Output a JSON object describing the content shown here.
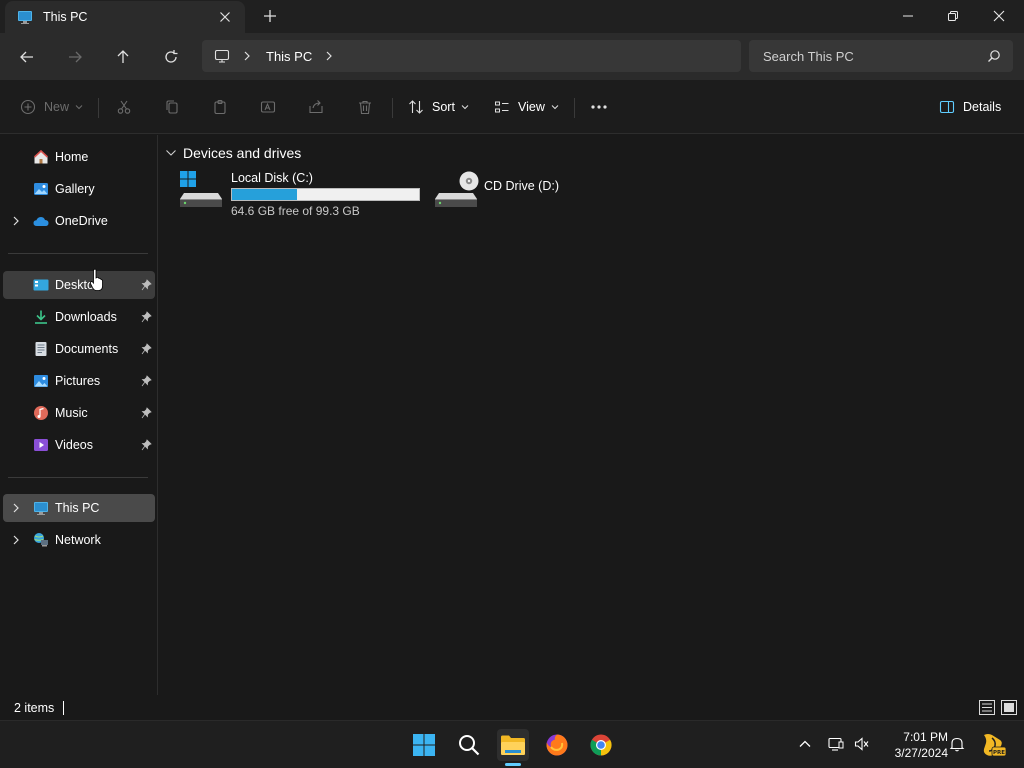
{
  "window": {
    "tab_title": "This PC",
    "controls": {
      "minimize": "minimize",
      "maximize": "restore",
      "close": "close"
    }
  },
  "address": {
    "crumbs": [
      "This PC"
    ],
    "search_placeholder": "Search This PC"
  },
  "commands": {
    "new_label": "New",
    "sort_label": "Sort",
    "view_label": "View",
    "details_label": "Details"
  },
  "sidebar": {
    "items": [
      {
        "label": "Home",
        "icon": "home-icon"
      },
      {
        "label": "Gallery",
        "icon": "gallery-icon"
      },
      {
        "label": "OneDrive",
        "icon": "cloud-icon"
      },
      {
        "label": "Deskto",
        "icon": "desktop-icon",
        "pinned": true
      },
      {
        "label": "Downloads",
        "icon": "download-icon",
        "pinned": true
      },
      {
        "label": "Documents",
        "icon": "documents-icon",
        "pinned": true
      },
      {
        "label": "Pictures",
        "icon": "pictures-icon",
        "pinned": true
      },
      {
        "label": "Music",
        "icon": "music-icon",
        "pinned": true
      },
      {
        "label": "Videos",
        "icon": "videos-icon",
        "pinned": true
      },
      {
        "label": "This PC",
        "icon": "computer-icon"
      },
      {
        "label": "Network",
        "icon": "network-icon"
      }
    ]
  },
  "content": {
    "group_title": "Devices and drives",
    "drives": [
      {
        "name": "Local Disk (C:)",
        "free_text": "64.6 GB free of 99.3 GB",
        "used_fraction": 0.35
      },
      {
        "name": "CD Drive (D:)"
      }
    ]
  },
  "status": {
    "item_count": "2 items"
  },
  "taskbar": {
    "time": "7:01 PM",
    "date": "3/27/2024"
  },
  "colors": {
    "accent": "#60cdff",
    "drive_bar": "#26a0da",
    "background": "#191919"
  }
}
